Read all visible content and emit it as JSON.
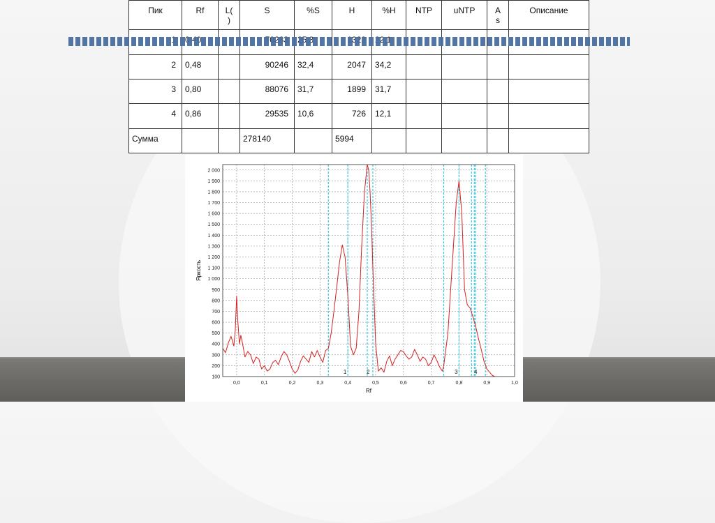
{
  "table": {
    "headers": [
      "Пик",
      "Rf",
      "L(\n)",
      "S",
      "%S",
      "H",
      "%H",
      "NTP",
      "uNTP",
      "A\ns",
      "Описание"
    ],
    "rows": [
      {
        "peak": "1",
        "rf": "0,40",
        "l": "",
        "s": "70283",
        "ps": "25,3",
        "h": "1322",
        "ph": "22,1",
        "ntp": "",
        "untp": "",
        "as": "",
        "desc": ""
      },
      {
        "peak": "2",
        "rf": "0,48",
        "l": "",
        "s": "90246",
        "ps": "32,4",
        "h": "2047",
        "ph": "34,2",
        "ntp": "",
        "untp": "",
        "as": "",
        "desc": ""
      },
      {
        "peak": "3",
        "rf": "0,80",
        "l": "",
        "s": "88076",
        "ps": "31,7",
        "h": "1899",
        "ph": "31,7",
        "ntp": "",
        "untp": "",
        "as": "",
        "desc": ""
      },
      {
        "peak": "4",
        "rf": "0,86",
        "l": "",
        "s": "29535",
        "ps": "10,6",
        "h": "726",
        "ph": "12,1",
        "ntp": "",
        "untp": "",
        "as": "",
        "desc": ""
      }
    ],
    "sum": {
      "label": "Сумма",
      "s": "278140",
      "h": "5994"
    }
  },
  "colors": {
    "trace": "#d42020",
    "marker": "#35c9e0",
    "stripe": "#4a6ea0",
    "grid": "#9a9a9a"
  },
  "chart_data": {
    "type": "line",
    "xlabel": "Rf",
    "ylabel": "Яркость",
    "xlim": [
      -0.05,
      1.0
    ],
    "ylim": [
      100,
      2050
    ],
    "xticks": [
      "0,0",
      "0,1",
      "0,2",
      "0,3",
      "0,4",
      "0,5",
      "0,6",
      "0,7",
      "0,8",
      "0,9",
      "1,0"
    ],
    "xtick_values": [
      0.0,
      0.1,
      0.2,
      0.3,
      0.4,
      0.5,
      0.6,
      0.7,
      0.8,
      0.9,
      1.0
    ],
    "yticks": [
      "100",
      "200",
      "300",
      "400",
      "500",
      "600",
      "700",
      "800",
      "900",
      "1 000",
      "1 100",
      "1 200",
      "1 300",
      "1 400",
      "1 500",
      "1 600",
      "1 700",
      "1 800",
      "1 900",
      "2 000"
    ],
    "ytick_values": [
      100,
      200,
      300,
      400,
      500,
      600,
      700,
      800,
      900,
      1000,
      1100,
      1200,
      1300,
      1400,
      1500,
      1600,
      1700,
      1800,
      1900,
      2000
    ],
    "grid": true,
    "markers": [
      0.33,
      0.4,
      0.47,
      0.49,
      0.745,
      0.8,
      0.845,
      0.855,
      0.86,
      0.895
    ],
    "peak_labels": [
      {
        "label": "1",
        "x": 0.39
      },
      {
        "label": "2",
        "x": 0.473
      },
      {
        "label": "3",
        "x": 0.79
      },
      {
        "label": "4",
        "x": 0.86
      }
    ],
    "series": [
      {
        "x": [
          -0.05,
          -0.04,
          -0.03,
          -0.02,
          -0.01,
          -0.005,
          0.0,
          0.004,
          0.01,
          0.015,
          0.02,
          0.03,
          0.04,
          0.05,
          0.06,
          0.07,
          0.08,
          0.09,
          0.1,
          0.11,
          0.12,
          0.13,
          0.14,
          0.15,
          0.16,
          0.17,
          0.18,
          0.19,
          0.2,
          0.21,
          0.22,
          0.23,
          0.24,
          0.25,
          0.26,
          0.27,
          0.28,
          0.29,
          0.3,
          0.31,
          0.32,
          0.33,
          0.34,
          0.35,
          0.36,
          0.37,
          0.38,
          0.39,
          0.4,
          0.41,
          0.42,
          0.43,
          0.44,
          0.45,
          0.46,
          0.47,
          0.475,
          0.48,
          0.485,
          0.49,
          0.5,
          0.51,
          0.52,
          0.53,
          0.54,
          0.55,
          0.56,
          0.57,
          0.58,
          0.59,
          0.6,
          0.61,
          0.62,
          0.63,
          0.64,
          0.65,
          0.66,
          0.67,
          0.68,
          0.69,
          0.7,
          0.71,
          0.72,
          0.73,
          0.74,
          0.745,
          0.75,
          0.76,
          0.77,
          0.78,
          0.79,
          0.8,
          0.81,
          0.82,
          0.83,
          0.84,
          0.85,
          0.86,
          0.87,
          0.88,
          0.89,
          0.9,
          0.91,
          0.92,
          0.93,
          0.94,
          0.95,
          0.96,
          0.97,
          0.98,
          0.99,
          1.0
        ],
        "y": [
          360,
          320,
          410,
          470,
          380,
          520,
          840,
          620,
          400,
          480,
          420,
          280,
          330,
          300,
          220,
          280,
          260,
          170,
          200,
          150,
          170,
          230,
          250,
          210,
          280,
          330,
          300,
          240,
          170,
          130,
          160,
          240,
          290,
          260,
          230,
          330,
          280,
          340,
          280,
          230,
          340,
          360,
          500,
          700,
          920,
          1150,
          1310,
          1200,
          850,
          380,
          300,
          360,
          700,
          1300,
          1800,
          2050,
          2000,
          1800,
          1500,
          1100,
          400,
          150,
          180,
          140,
          240,
          290,
          200,
          260,
          300,
          340,
          330,
          290,
          260,
          280,
          350,
          300,
          240,
          280,
          260,
          200,
          230,
          300,
          250,
          190,
          150,
          200,
          300,
          500,
          900,
          1300,
          1700,
          1899,
          1600,
          900,
          760,
          730,
          650,
          560,
          450,
          350,
          240,
          170,
          140,
          110,
          100,
          90,
          80,
          75,
          70,
          65,
          60,
          60
        ]
      }
    ]
  }
}
